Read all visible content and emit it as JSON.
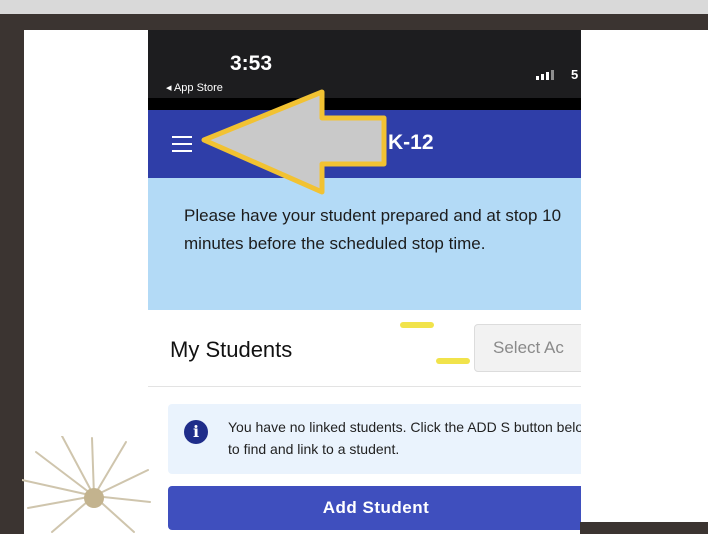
{
  "status_bar": {
    "time": "3:53",
    "back_label": "◂ App Store",
    "carrier": "5"
  },
  "app_bar": {
    "title": "K-12"
  },
  "notice": {
    "text": "Please have your student prepared and at stop 10 minutes before the scheduled stop time."
  },
  "students": {
    "heading": "My Students",
    "select_placeholder": "Select Ac",
    "info_message": "You have no linked students. Click the ADD S button below to find and link to a student.",
    "add_button_label": "Add Student"
  },
  "colors": {
    "app_bar": "#2f3ea8",
    "notice_bg": "#b3daf6",
    "button": "#3f4fbe",
    "arrow_outline": "#f2c232",
    "arrow_fill": "#c9c9c9"
  },
  "icons": [
    "menu-icon",
    "info-icon",
    "signal-icon",
    "pointing-arrow"
  ]
}
